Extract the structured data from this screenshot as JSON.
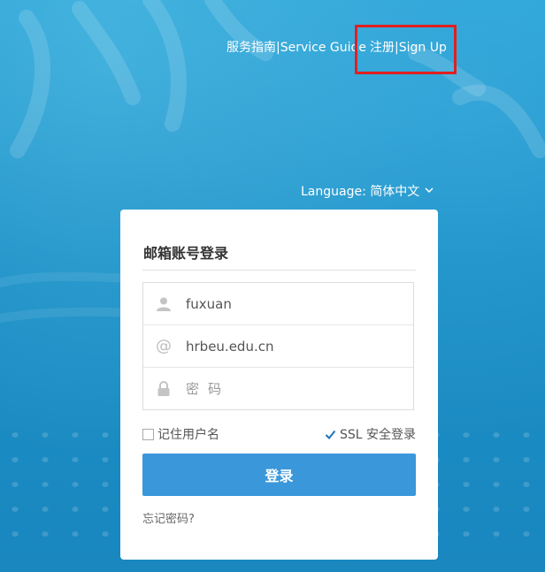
{
  "header": {
    "service_guide": "服务指南|Service Guide",
    "signup": "注册|Sign Up"
  },
  "language": {
    "label": "Language: 简体中文"
  },
  "login": {
    "title": "邮箱账号登录",
    "username_value": "fuxuan",
    "domain_value": "hrbeu.edu.cn",
    "password_placeholder": "密码",
    "remember_label": "记住用户名",
    "remember_checked": false,
    "ssl_label": "SSL 安全登录",
    "ssl_checked": true,
    "submit_label": "登录",
    "forgot_label": "忘记密码?"
  },
  "colors": {
    "background": "#1e8fc4",
    "button": "#3a97da",
    "highlight": "#e02020"
  }
}
